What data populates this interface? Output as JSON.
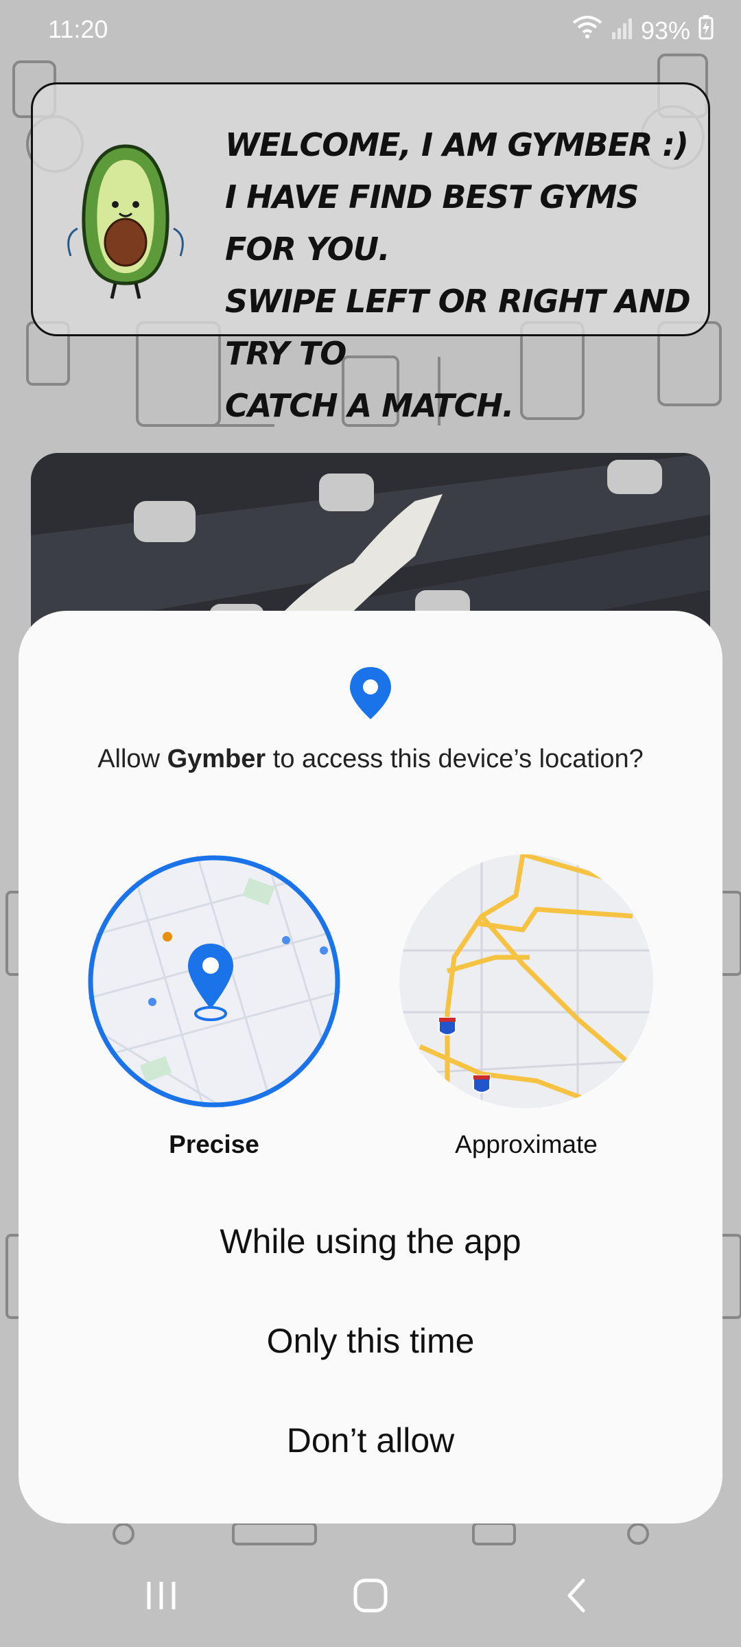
{
  "status_bar": {
    "time": "11:20",
    "battery": "93%"
  },
  "welcome": {
    "lines": [
      "Welcome, I am Gymber :)",
      "I have find best gyms for you.",
      "Swipe left or right and try to",
      "catch a match."
    ]
  },
  "permission": {
    "question_prefix": "Allow ",
    "app_name": "Gymber",
    "question_suffix": " to access this device’s location?",
    "options": {
      "precise": "Precise",
      "approximate": "Approximate"
    },
    "choices": {
      "while_using": "While using the app",
      "only_this_time": "Only this time",
      "dont_allow": "Don’t allow"
    }
  },
  "colors": {
    "accent": "#1a73e8",
    "sheet": "#fafafa",
    "road": "#f5c242"
  },
  "icons": [
    "location-pin-icon",
    "wifi-icon",
    "signal-icon",
    "battery-icon",
    "recents-icon",
    "home-icon",
    "back-icon"
  ]
}
